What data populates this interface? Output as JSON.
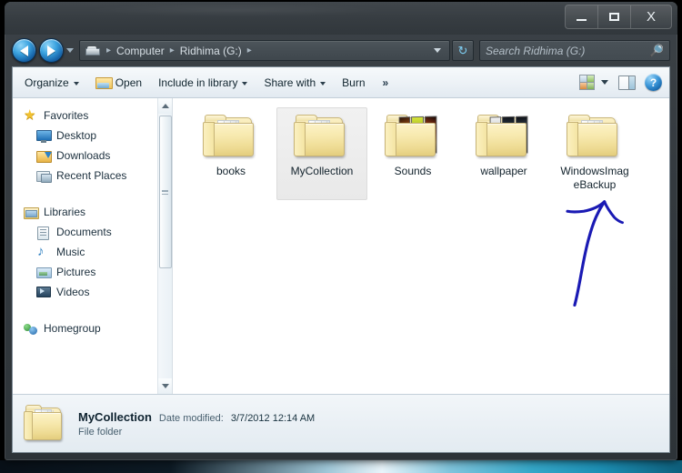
{
  "window": {
    "controls": {
      "minimize": "–",
      "maximize": "▭",
      "close": "X"
    }
  },
  "address_bar": {
    "back_icon": "back-arrow-icon",
    "forward_icon": "forward-arrow-icon",
    "history_dropdown_icon": "chevron-down-icon",
    "breadcrumb_root_icon": "computer-icon",
    "breadcrumb": [
      "Computer",
      "Ridhima (G:)"
    ],
    "separator": "▸",
    "refresh_icon": "↻",
    "search": {
      "placeholder": "Search Ridhima (G:)",
      "value": "",
      "icon": "search-icon"
    }
  },
  "toolbar": {
    "organize_label": "Organize",
    "open_label": "Open",
    "include_label": "Include in library",
    "share_label": "Share with",
    "burn_label": "Burn",
    "overflow_label": "»",
    "views_icon": "views-grid-icon",
    "preview_pane_icon": "preview-pane-icon",
    "help_label": "?"
  },
  "nav_pane": {
    "groups": [
      {
        "header": {
          "label": "Favorites",
          "icon": "star-icon"
        },
        "items": [
          {
            "label": "Desktop",
            "icon": "desktop-icon"
          },
          {
            "label": "Downloads",
            "icon": "downloads-folder-icon"
          },
          {
            "label": "Recent Places",
            "icon": "recent-places-icon"
          }
        ]
      },
      {
        "header": {
          "label": "Libraries",
          "icon": "libraries-icon"
        },
        "items": [
          {
            "label": "Documents",
            "icon": "documents-icon"
          },
          {
            "label": "Music",
            "icon": "music-icon"
          },
          {
            "label": "Pictures",
            "icon": "pictures-icon"
          },
          {
            "label": "Videos",
            "icon": "videos-icon"
          }
        ]
      },
      {
        "header": {
          "label": "Homegroup",
          "icon": "homegroup-icon"
        },
        "items": []
      }
    ],
    "scrollbar": {
      "up_icon": "scroll-up-arrow-icon",
      "down_icon": "scroll-down-arrow-icon"
    }
  },
  "content": {
    "items": [
      {
        "name": "books",
        "type": "folder",
        "selected": false,
        "thumbs": false
      },
      {
        "name": "MyCollection",
        "type": "folder",
        "selected": true,
        "thumbs": false
      },
      {
        "name": "Sounds",
        "type": "folder",
        "selected": false,
        "thumbs": true,
        "thumb_style": "s"
      },
      {
        "name": "wallpaper",
        "type": "folder",
        "selected": false,
        "thumbs": true,
        "thumb_style": "w"
      },
      {
        "name": "WindowsImageBackup",
        "type": "folder",
        "selected": false,
        "thumbs": false
      }
    ],
    "annotation": {
      "shape": "hand-drawn-arrow",
      "color": "#1a1ab4",
      "points_to": "WindowsImageBackup"
    }
  },
  "details_pane": {
    "icon": "folder-icon",
    "name": "MyCollection",
    "meta_label": "Date modified:",
    "meta_value": "3/7/2012 12:14 AM",
    "type": "File folder"
  },
  "colors": {
    "frame": "#343a3f",
    "accent_blue": "#2c82c9",
    "annotation_blue": "#1a1ab4",
    "selection": "#e9e9e9"
  }
}
